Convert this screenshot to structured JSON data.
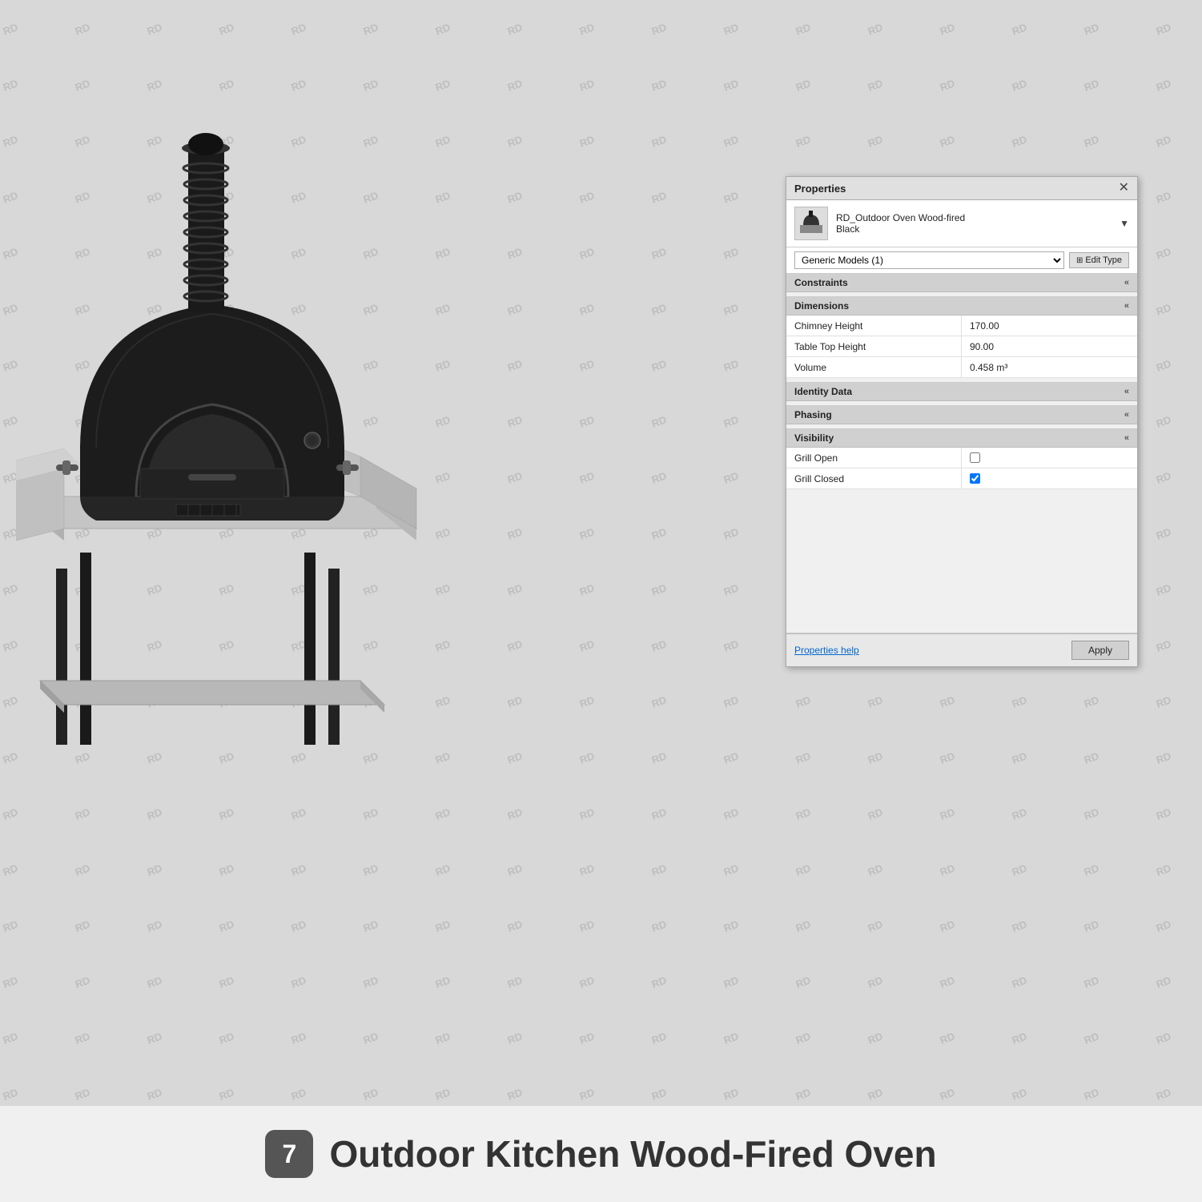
{
  "watermark": {
    "text": "RD",
    "color": "rgba(150,150,150,0.45)"
  },
  "panel": {
    "title": "Properties",
    "close_icon": "✕",
    "object": {
      "name_line1": "RD_Outdoor Oven Wood-fired",
      "name_line2": "Black"
    },
    "type_selector": {
      "value": "Generic Models (1)",
      "edit_type_label": "Edit Type"
    },
    "sections": [
      {
        "id": "constraints",
        "label": "Constraints",
        "toggle": "«",
        "rows": []
      },
      {
        "id": "dimensions",
        "label": "Dimensions",
        "toggle": "«",
        "rows": [
          {
            "label": "Chimney Height",
            "value": "170.00",
            "type": "text"
          },
          {
            "label": "Table Top Height",
            "value": "90.00",
            "type": "text"
          },
          {
            "label": "Volume",
            "value": "0.458 m³",
            "type": "text"
          }
        ]
      },
      {
        "id": "identity_data",
        "label": "Identity Data",
        "toggle": "«",
        "rows": []
      },
      {
        "id": "phasing",
        "label": "Phasing",
        "toggle": "«",
        "rows": []
      },
      {
        "id": "visibility",
        "label": "Visibility",
        "toggle": "«",
        "rows": [
          {
            "label": "Grill Open",
            "value": "",
            "type": "checkbox",
            "checked": false
          },
          {
            "label": "Grill Closed",
            "value": "",
            "type": "checkbox",
            "checked": true
          }
        ]
      }
    ],
    "footer": {
      "help_link": "Properties help",
      "apply_button": "Apply"
    }
  },
  "bottom_bar": {
    "number": "7",
    "title": "Outdoor Kitchen Wood-Fired Oven"
  }
}
